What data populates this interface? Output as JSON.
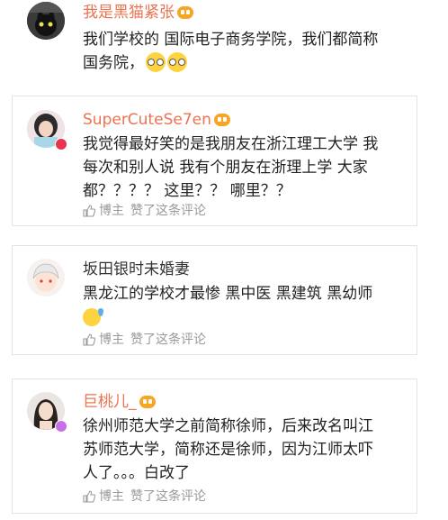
{
  "comments": [
    {
      "username": "我是黑猫紧张",
      "text_lines": [
        "我们学校的 国际电子商务学院，我们都简称",
        "国务院，"
      ],
      "emojis": [
        "nerd-glasses-emoji",
        "nerd-glasses-emoji"
      ],
      "avatar": "avatar-black-cat"
    },
    {
      "username": "SuperCuteSe7en",
      "text_lines": [
        "我觉得最好笑的是我朋友在浙江理工大学 我",
        "每次和别人说 我有个朋友在浙理上学 大家",
        "都？？？？ 这里？？ 哪里？？"
      ],
      "author_label": "博主",
      "liked_label": "赞了这条评论",
      "avatar": "avatar-girl-pink-hair"
    },
    {
      "username": "坂田银时未婚妻",
      "text_lines": [
        "黑龙江的学校才最惨 黑中医 黑建筑 黑幼师"
      ],
      "emojis": [
        "sweat-emoji"
      ],
      "author_label": "博主",
      "liked_label": "赞了这条评论",
      "avatar": "avatar-anime-white-hair"
    },
    {
      "username": "巨桃儿_",
      "text_lines": [
        "徐州师范大学之前简称徐师，后来改名叫江",
        "苏师范大学，简称还是徐师，因为江师太吓",
        "人了。。。白改了"
      ],
      "author_label": "博主",
      "liked_label": "赞了这条评论",
      "avatar": "avatar-woman-dark-hair"
    }
  ],
  "colors": {
    "username_vip": "#eb7350",
    "username_normal": "#333333",
    "text": "#222222",
    "meta": "#999999",
    "border": "#e3e3e3",
    "vip_badge": "#f6a623",
    "verified_red": "#e8334a",
    "verified_purple": "#c86ee8"
  }
}
